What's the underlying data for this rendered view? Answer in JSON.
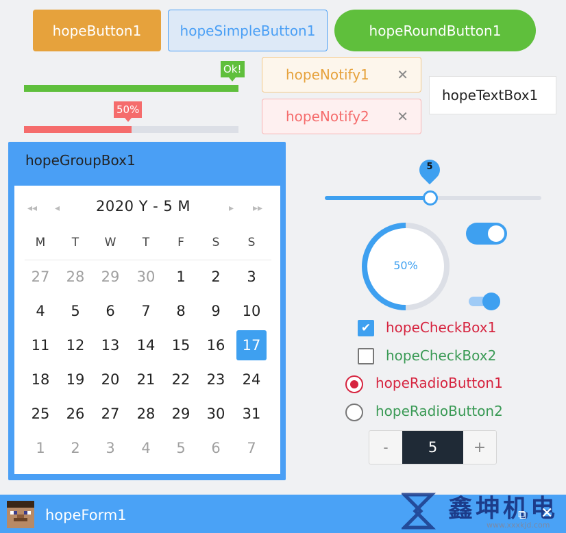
{
  "buttons": {
    "button1": "hopeButton1",
    "simple_button": "hopeSimpleButton1",
    "round_button": "hopeRoundButton1"
  },
  "progress": {
    "bar1": {
      "value": 1.0,
      "tag": "Ok!"
    },
    "bar2": {
      "value": 0.5,
      "tag": "50%"
    }
  },
  "notify": {
    "notify1": "hopeNotify1",
    "notify2": "hopeNotify2",
    "close_glyph": "✕"
  },
  "textbox": {
    "value": "hopeTextBox1"
  },
  "groupbox": {
    "title": "hopeGroupBox1"
  },
  "calendar": {
    "month_label": "2020 Y -  5 M",
    "weekdays": [
      "M",
      "T",
      "W",
      "T",
      "F",
      "S",
      "S"
    ],
    "days": [
      [
        "27",
        "28",
        "29",
        "30",
        "1",
        "2",
        "3"
      ],
      [
        "4",
        "5",
        "6",
        "7",
        "8",
        "9",
        "10"
      ],
      [
        "11",
        "12",
        "13",
        "14",
        "15",
        "16",
        "17"
      ],
      [
        "18",
        "19",
        "20",
        "21",
        "22",
        "23",
        "24"
      ],
      [
        "25",
        "26",
        "27",
        "28",
        "29",
        "30",
        "31"
      ],
      [
        "1",
        "2",
        "3",
        "4",
        "5",
        "6",
        "7"
      ]
    ],
    "selected": "17"
  },
  "slider": {
    "value": "5"
  },
  "ring": {
    "value": 0.5,
    "label": "50%"
  },
  "switches": {
    "switch1": true,
    "switch2": true
  },
  "checkboxes": {
    "check1": {
      "label": "hopeCheckBox1",
      "checked": true
    },
    "check2": {
      "label": "hopeCheckBox2",
      "checked": false
    }
  },
  "radios": {
    "radio1": {
      "label": "hopeRadioButton1",
      "checked": true
    },
    "radio2": {
      "label": "hopeRadioButton2",
      "checked": false
    }
  },
  "stepper": {
    "minus": "-",
    "value": "5",
    "plus": "+"
  },
  "form": {
    "title": "hopeForm1",
    "maximize": "⧉",
    "close": "✕"
  },
  "watermark": {
    "text": "鑫坤机电",
    "url": "www.xxxkjd.com"
  },
  "colors": {
    "primary": "#4a9ff5",
    "warning": "#e6a23c",
    "success": "#5fbf3c",
    "danger": "#f56c6c",
    "checkbox_red": "#d6243f",
    "checkbox_green": "#3a9a55"
  },
  "icons": [
    "first-page-icon",
    "prev-icon",
    "next-icon",
    "last-page-icon",
    "close-icon",
    "maximize-icon",
    "check-icon",
    "avatar-icon"
  ]
}
